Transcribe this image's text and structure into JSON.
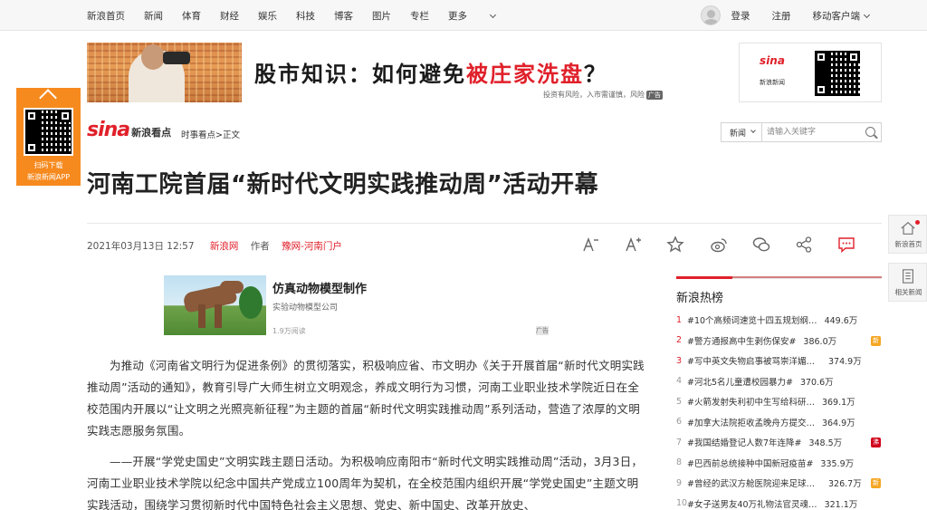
{
  "topnav": {
    "items": [
      "新浪首页",
      "新闻",
      "体育",
      "财经",
      "娱乐",
      "科技",
      "博客",
      "图片",
      "专栏"
    ],
    "more": "更多",
    "login": "登录",
    "register": "注册",
    "mobile": "移动客户端"
  },
  "banner": {
    "headline_prefix": "股市知识：如何避免",
    "headline_red": "被庄家洗盘",
    "headline_suffix": "？",
    "note": "投资有风险，入市需谨慎，风险",
    "ad_tag": "广告",
    "right_logo": "sina",
    "right_caption": "新浪新闻"
  },
  "left_float": {
    "line1": "扫码下载",
    "line2": "新浪新闻APP"
  },
  "header": {
    "logo": "sina",
    "logo_sub": "新浪看点",
    "breadcrumb": "时事看点>正文"
  },
  "search": {
    "channel": "新闻",
    "placeholder": "请输入关键字"
  },
  "article": {
    "title": "河南工院首届“新时代文明实践推动周”活动开幕",
    "date": "2021年03月13日 12:57",
    "source": "新浪网",
    "author_label": "作者",
    "author": "豫网-河南门户",
    "paragraphs": [
      "为推动《河南省文明行为促进条例》的贯彻落实，积极响应省、市文明办《关于开展首届“新时代文明实践推动周”活动的通知》，教育引导广大师生树立文明观念，养成文明行为习惯，河南工业职业技术学院近日在全校范围内开展以“让文明之光照亮新征程”为主题的首届“新时代文明实践推动周”系列活动，营造了浓厚的文明实践志愿服务氛围。",
      "——开展“学党史国史”文明实践主题日活动。为积极响应南阳市“新时代文明实践推动周”活动，3月3日，河南工业职业技术学院以纪念中国共产党成立100周年为契机，在全校范围内组织开展“学党史国史”主题文明实践活动，围绕学习贯彻新时代中国特色社会主义思想、党史、新中国史、改革开放史、"
    ]
  },
  "ad": {
    "title": "仿真动物模型制作",
    "subtitle": "实验动物模型公司",
    "reads": "1.9万阅读",
    "badge": "广告"
  },
  "hot": {
    "title": "新浪热榜",
    "items": [
      {
        "rank": "1",
        "text": "#10个高频词速览十四五规划纲…",
        "count": "449.6万",
        "tag": "",
        "tag_color": ""
      },
      {
        "rank": "2",
        "text": "#警方通报高中生剥伤保安#",
        "count": "386.0万",
        "tag": "新",
        "tag_color": "#f5a623"
      },
      {
        "rank": "3",
        "text": "#写中英文失物启事被骂崇洋媚外#",
        "count": "374.9万",
        "tag": "",
        "tag_color": ""
      },
      {
        "rank": "4",
        "text": "#河北5名儿童遭校园暴力#",
        "count": "370.6万",
        "tag": "",
        "tag_color": ""
      },
      {
        "rank": "5",
        "text": "#火箭发射失利初中生写给科研…",
        "count": "369.1万",
        "tag": "",
        "tag_color": ""
      },
      {
        "rank": "6",
        "text": "#加拿大法院拒收孟晚舟方提交…",
        "count": "364.9万",
        "tag": "",
        "tag_color": ""
      },
      {
        "rank": "7",
        "text": "#我国结婚登记人数7年连降#",
        "count": "348.5万",
        "tag": "沸",
        "tag_color": "#d0021b"
      },
      {
        "rank": "8",
        "text": "#巴西前总统接种中国新冠疫苗#",
        "count": "335.9万",
        "tag": "",
        "tag_color": ""
      },
      {
        "rank": "9",
        "text": "#曾经的武汉方舱医院迎来足球赛#",
        "count": "326.7万",
        "tag": "新",
        "tag_color": "#f5a623"
      },
      {
        "rank": "10",
        "text": "#女子送男友40万礼物法官灵魂…",
        "count": "321.1万",
        "tag": "",
        "tag_color": ""
      }
    ]
  },
  "right_float": {
    "home": "新浪首页",
    "related": "相关新闻"
  },
  "colors": {
    "brand_red": "#e0202a",
    "orange": "#f68a1f"
  }
}
